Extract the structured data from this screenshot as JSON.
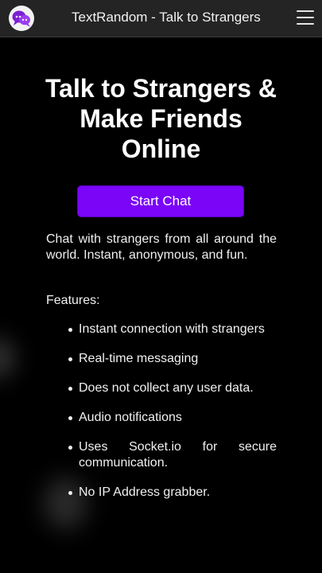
{
  "header": {
    "title": "TextRandom - Talk to Strangers",
    "logo_icon": "chat-bubbles-icon",
    "menu_icon": "hamburger-menu-icon"
  },
  "hero": {
    "headline": "Talk to Strangers & Make Friends Online",
    "cta_label": "Start Chat"
  },
  "intro": "Chat with strangers from all around the world. Instant, anonymous, and fun.",
  "features": {
    "label": "Features:",
    "items": [
      "Instant connection with strangers",
      "Real-time messaging",
      "Does not collect any user data.",
      "Audio notifications",
      "Uses Socket.io for secure communication.",
      "No IP Address grabber."
    ]
  },
  "colors": {
    "background": "#000000",
    "topbar": "#242424",
    "accent": "#7a05f7",
    "logo_accent": "#7b1fd4",
    "text": "#ffffff"
  }
}
